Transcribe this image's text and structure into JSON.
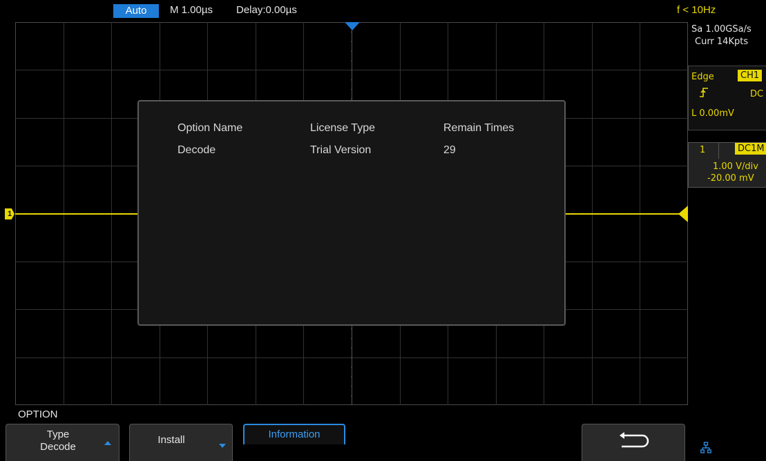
{
  "status_bar": {
    "trigger_mode": "Auto",
    "timebase": "M 1.00µs",
    "delay": "Delay:0.00µs",
    "frequency": "f < 10Hz"
  },
  "acquisition": {
    "sample_rate": "Sa 1.00GSa/s",
    "memory_depth": "Curr 14Kpts"
  },
  "trigger": {
    "type": "Edge",
    "source": "CH1",
    "slope_icon": "rising-edge-icon",
    "coupling": "DC",
    "level": "L  0.00mV"
  },
  "channel": {
    "number": "1",
    "coupling": "DC1M",
    "scale": "1.00 V/div",
    "offset": "-20.00 mV",
    "marker": "1"
  },
  "dialog": {
    "headers": [
      "Option Name",
      "License Type",
      "Remain Times"
    ],
    "rows": [
      [
        "Decode",
        "Trial Version",
        "29"
      ]
    ]
  },
  "menu": {
    "title": "OPTION",
    "type_label": "Type",
    "type_value": "Decode",
    "install_label": "Install",
    "information_label": "Information",
    "back_icon": "return-arrow-icon",
    "network_icon": "network-icon"
  },
  "colors": {
    "channel1": "#e8d800",
    "accent": "#2a8be0",
    "background": "#000000"
  }
}
